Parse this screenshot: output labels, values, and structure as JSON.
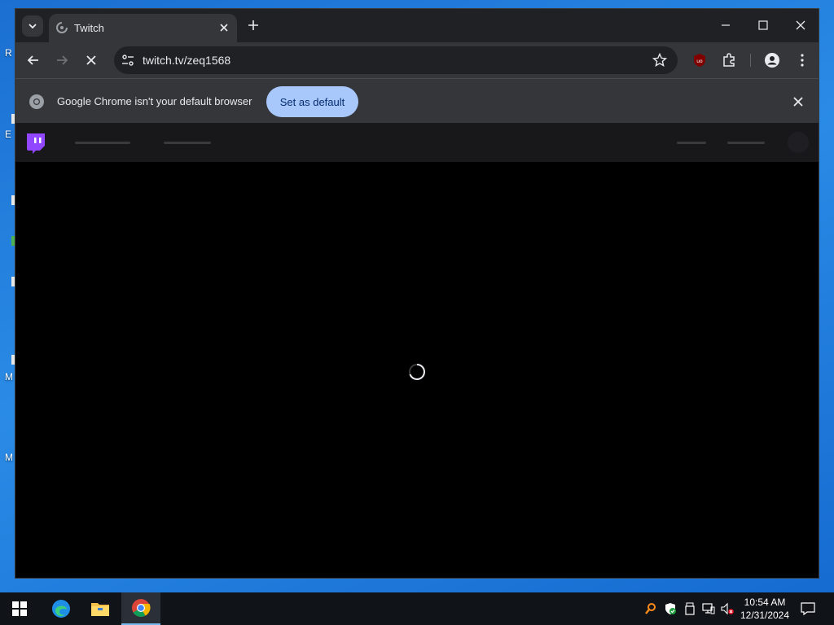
{
  "browser": {
    "tab_title": "Twitch",
    "url": "twitch.tv/zeq1568",
    "infobar_text": "Google Chrome isn't your default browser",
    "infobar_button": "Set as default"
  },
  "desktop": {
    "edge_chars": [
      "R",
      "E",
      "M",
      "M"
    ]
  },
  "taskbar": {
    "time": "10:54 AM",
    "date": "12/31/2024"
  },
  "icons": {
    "tab_search": "chevron-down-icon",
    "favicon": "loading-icon",
    "back": "back-arrow-icon",
    "forward": "forward-arrow-icon",
    "stop": "stop-icon",
    "site_info": "tune-icon",
    "bookmark": "star-icon",
    "extension": "ublock-icon",
    "extensions": "puzzle-icon",
    "profile": "profile-icon",
    "menu": "kebab-menu-icon"
  },
  "colors": {
    "twitch_purple": "#9146ff",
    "button_blue": "#a8c7fa"
  }
}
